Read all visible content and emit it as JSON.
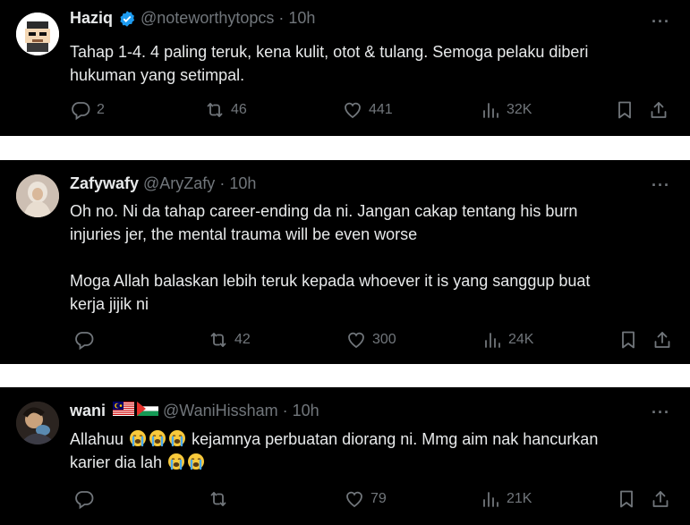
{
  "tweets": [
    {
      "name": "Haziq",
      "handle": "@noteworthytopcs",
      "dot": "·",
      "time": "10h",
      "more": "···",
      "text": [
        "Tahap 1-4. 4 paling teruk, kena kulit, otot & tulang. Semoga pelaku diberi",
        "hukuman yang setimpal."
      ],
      "replies": "2",
      "reposts": "46",
      "likes": "441",
      "views": "32K"
    },
    {
      "name": "Zafywafy",
      "handle": "@AryZafy",
      "dot": "·",
      "time": "10h",
      "more": "···",
      "text1": [
        "Oh no. Ni da tahap career-ending da ni. Jangan cakap tentang his burn",
        "injuries jer, the mental trauma will be even worse"
      ],
      "text2": [
        "Moga Allah balaskan lebih teruk kepada whoever it is yang sanggup buat",
        "kerja jijik ni"
      ],
      "replies": "",
      "reposts": "42",
      "likes": "300",
      "views": "24K"
    },
    {
      "name": "wani",
      "handle": "@WaniHissham",
      "dot": "·",
      "time": "10h",
      "more": "···",
      "text_a": "Allahuu",
      "text_b": "kejamnya perbuatan diorang ni. Mmg aim nak hancurkan",
      "text_c": "karier dia lah",
      "emoji": "loudly-crying-face",
      "replies": "",
      "reposts": "",
      "likes": "79",
      "views": "21K"
    }
  ],
  "colors": {
    "background": "#000000",
    "text": "#e7e9ea",
    "muted": "#71767b",
    "verified": "#1d9bf0",
    "separator": "#ffffff"
  }
}
